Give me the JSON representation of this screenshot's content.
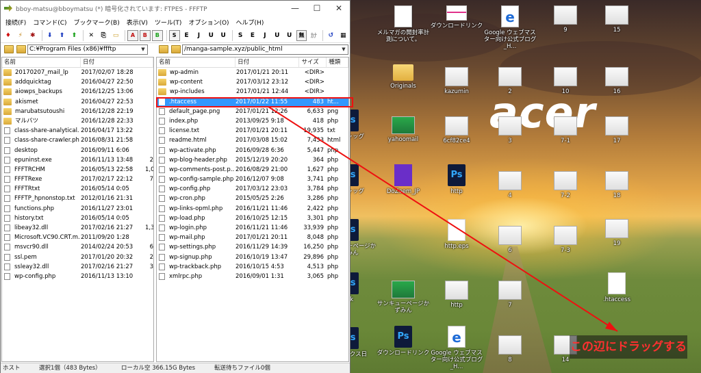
{
  "window": {
    "title": "bboy-matsu@bboymatsu (*) 暗号化されています: FTPES - FFFTP",
    "controls": {
      "minimize": "—",
      "maximize": "☐",
      "close": "✕"
    }
  },
  "menu": [
    "接続(F)",
    "コマンド(C)",
    "ブックマーク(B)",
    "表示(V)",
    "ツール(T)",
    "オプション(O)",
    "ヘルプ(H)"
  ],
  "toolbar_buttons": [
    "connect-icon",
    "quick-connect-icon",
    "disconnect-icon",
    "download-icon",
    "upload-icon",
    "mirror-upload-icon",
    "delete-icon",
    "rename-icon",
    "mkdir-icon",
    "ascii-icon",
    "binary-icon",
    "auto-icon",
    "sjis",
    "euc",
    "jis",
    "utf8",
    "utf8bom",
    "none",
    "kana",
    "refresh-icon",
    "list-icon"
  ],
  "toolbar_labels": {
    "ascii": "A",
    "binary": "B",
    "auto": "B",
    "sjis_l": "S",
    "euc_l": "E",
    "jis_l": "J",
    "utf8_l": "U",
    "utf8b_l": "U",
    "none_l": "無",
    "sjis_r": "S",
    "euc_r": "E",
    "jis_r": "J",
    "utf8_r": "U",
    "utf8b_r": "U",
    "none_r": "無",
    "kana": "ｶﾅ"
  },
  "local": {
    "path": "C:¥Program Files (x86)¥ffftp",
    "columns": {
      "name": "名前",
      "date": "日付"
    },
    "files": [
      {
        "type": "folder",
        "name": "20170207_mail_lp",
        "date": "2017/02/07 18:28",
        "size": ""
      },
      {
        "type": "folder",
        "name": "addquicktag",
        "date": "2016/04/27 22:50",
        "size": ""
      },
      {
        "type": "folder",
        "name": "aiowps_backups",
        "date": "2016/12/25 13:06",
        "size": ""
      },
      {
        "type": "folder",
        "name": "akismet",
        "date": "2016/04/27 22:53",
        "size": ""
      },
      {
        "type": "folder",
        "name": "marubatsutoushi",
        "date": "2016/12/28 22:19",
        "size": ""
      },
      {
        "type": "folder",
        "name": "マルバツ",
        "date": "2016/12/28 22:33",
        "size": ""
      },
      {
        "type": "file",
        "name": "class-share-analytical...",
        "date": "2016/04/17 13:22",
        "size": ""
      },
      {
        "type": "file",
        "name": "class-share-crawler.php",
        "date": "2016/08/31 21:58",
        "size": ""
      },
      {
        "type": "file",
        "name": "desktop",
        "date": "2016/09/11  6:06",
        "size": ""
      },
      {
        "type": "file",
        "name": "epuninst.exe",
        "date": "2016/11/13 13:48",
        "size": "2"
      },
      {
        "type": "file",
        "name": "FFFTRCHM",
        "date": "2016/05/13 22:58",
        "size": "1,0"
      },
      {
        "type": "file",
        "name": "FFFTRexe",
        "date": "2017/02/17 22:12",
        "size": "7"
      },
      {
        "type": "file",
        "name": "FFFTRtxt",
        "date": "2016/05/14  0:05",
        "size": ""
      },
      {
        "type": "file",
        "name": "FFFTP_hpnonstop.txt",
        "date": "2012/01/16 21:31",
        "size": ""
      },
      {
        "type": "file",
        "name": "functions.php",
        "date": "2016/11/27 23:01",
        "size": ""
      },
      {
        "type": "file",
        "name": "history.txt",
        "date": "2016/05/14  0:05",
        "size": ""
      },
      {
        "type": "file",
        "name": "libeay32.dll",
        "date": "2017/02/16 21:27",
        "size": "1,3"
      },
      {
        "type": "file",
        "name": "Microsoft.VC90.CRT.m...",
        "date": "2011/09/20  1:28",
        "size": ""
      },
      {
        "type": "file",
        "name": "msvcr90.dll",
        "date": "2014/02/24 20:53",
        "size": "6"
      },
      {
        "type": "file",
        "name": "ssl.pem",
        "date": "2017/01/20 20:32",
        "size": "2"
      },
      {
        "type": "file",
        "name": "ssleay32.dll",
        "date": "2017/02/16 21:27",
        "size": "3"
      },
      {
        "type": "file",
        "name": "wp-config.php",
        "date": "2016/11/13 13:10",
        "size": ""
      }
    ]
  },
  "remote": {
    "path": "/manga-sample.xyz/public_html",
    "columns": {
      "name": "名前",
      "date": "日付",
      "size": "サイズ",
      "kind": "種類"
    },
    "files": [
      {
        "type": "folder",
        "name": "wp-admin",
        "date": "2017/01/21 20:11",
        "size": "<DIR>",
        "kind": ""
      },
      {
        "type": "folder",
        "name": "wp-content",
        "date": "2017/03/12 23:12",
        "size": "<DIR>",
        "kind": ""
      },
      {
        "type": "folder",
        "name": "wp-includes",
        "date": "2017/01/21 12:44",
        "size": "<DIR>",
        "kind": ""
      },
      {
        "type": "file",
        "name": ".htaccess",
        "date": "2017/01/22 11:55",
        "size": "483",
        "kind": "ht...",
        "selected": true
      },
      {
        "type": "file",
        "name": "default_page.png",
        "date": "2017/01/21 12:26",
        "size": "6,633",
        "kind": "png"
      },
      {
        "type": "file",
        "name": "index.php",
        "date": "2013/09/25  9:18",
        "size": "418",
        "kind": "php"
      },
      {
        "type": "file",
        "name": "license.txt",
        "date": "2017/01/21 20:11",
        "size": "19,935",
        "kind": "txt"
      },
      {
        "type": "file",
        "name": "readme.html",
        "date": "2017/03/08 15:02",
        "size": "7,433",
        "kind": "html"
      },
      {
        "type": "file",
        "name": "wp-activate.php",
        "date": "2016/09/28  6:36",
        "size": "5,447",
        "kind": "php"
      },
      {
        "type": "file",
        "name": "wp-blog-header.php",
        "date": "2015/12/19 20:20",
        "size": "364",
        "kind": "php"
      },
      {
        "type": "file",
        "name": "wp-comments-post.p...",
        "date": "2016/08/29 21:00",
        "size": "1,627",
        "kind": "php"
      },
      {
        "type": "file",
        "name": "wp-config-sample.php",
        "date": "2016/12/07  9:08",
        "size": "3,741",
        "kind": "php"
      },
      {
        "type": "file",
        "name": "wp-config.php",
        "date": "2017/03/12 23:03",
        "size": "3,784",
        "kind": "php"
      },
      {
        "type": "file",
        "name": "wp-cron.php",
        "date": "2015/05/25  2:26",
        "size": "3,286",
        "kind": "php"
      },
      {
        "type": "file",
        "name": "wp-links-opml.php",
        "date": "2016/11/21 11:46",
        "size": "2,422",
        "kind": "php"
      },
      {
        "type": "file",
        "name": "wp-load.php",
        "date": "2016/10/25 12:15",
        "size": "3,301",
        "kind": "php"
      },
      {
        "type": "file",
        "name": "wp-login.php",
        "date": "2016/11/21 11:46",
        "size": "33,939",
        "kind": "php"
      },
      {
        "type": "file",
        "name": "wp-mail.php",
        "date": "2017/01/21 20:11",
        "size": "8,048",
        "kind": "php"
      },
      {
        "type": "file",
        "name": "wp-settings.php",
        "date": "2016/11/29 14:39",
        "size": "16,250",
        "kind": "php"
      },
      {
        "type": "file",
        "name": "wp-signup.php",
        "date": "2016/10/19 13:47",
        "size": "29,896",
        "kind": "php"
      },
      {
        "type": "file",
        "name": "wp-trackback.php",
        "date": "2016/10/15  4:53",
        "size": "4,513",
        "kind": "php"
      },
      {
        "type": "file",
        "name": "xmlrpc.php",
        "date": "2016/09/01  1:31",
        "size": "3,065",
        "kind": "php"
      }
    ]
  },
  "statusbar": {
    "mode": "ホスト",
    "selection": "選択1個（483 Bytes）",
    "local_free": "ローカル空 366.15G Bytes",
    "transfer_queue": "転送待ちファイル0個"
  },
  "desktop": {
    "brand_logo": "acer",
    "icons": [
      {
        "label": "メルマガの開封率計測について。",
        "glyph": "g-doc"
      },
      {
        "label": "ダウンロードリンク",
        "glyph": "g-pinkstripe"
      },
      {
        "label": "Google ウェブマスター向け公式ブログ_H...",
        "glyph": "g-ie"
      },
      {
        "label": "9",
        "glyph": "g-thumb"
      },
      {
        "label": "15",
        "glyph": "g-thumb"
      },
      {
        "label": "Originals",
        "glyph": "g-folder"
      },
      {
        "label": "kazumin",
        "glyph": "g-thumb"
      },
      {
        "label": "2",
        "glyph": "g-thumb"
      },
      {
        "label": "10",
        "glyph": "g-thumb"
      },
      {
        "label": "16",
        "glyph": "g-thumb"
      },
      {
        "label": "ージャッグ",
        "glyph": "g-ps"
      },
      {
        "label": "yahoomail",
        "glyph": "g-green"
      },
      {
        "label": "6cf82ce4",
        "glyph": "g-thumb"
      },
      {
        "label": "3",
        "glyph": "g-thumb"
      },
      {
        "label": "7-1",
        "glyph": "g-thumb"
      },
      {
        "label": "17",
        "glyph": "g-thumb"
      },
      {
        "label": "ージャッグ",
        "glyph": "g-ps"
      },
      {
        "label": "DoZeem_JP",
        "glyph": "g-purple"
      },
      {
        "label": "http",
        "glyph": "g-ps"
      },
      {
        "label": "4",
        "glyph": "g-thumb"
      },
      {
        "label": "7-2",
        "glyph": "g-thumb"
      },
      {
        "label": "18",
        "glyph": "g-thumb"
      },
      {
        "label": "サンキューページかずみん",
        "glyph": "g-ps"
      },
      {
        "label": "http.eps",
        "glyph": "g-blank"
      },
      {
        "label": "6",
        "glyph": "g-thumb"
      },
      {
        "label": "7-3",
        "glyph": "g-thumb"
      },
      {
        "label": "19",
        "glyph": "g-thumb"
      },
      {
        "label": "nk",
        "glyph": "g-ps"
      },
      {
        "label": "サンキューページかずみん",
        "glyph": "g-green"
      },
      {
        "label": "http",
        "glyph": "g-thumb"
      },
      {
        "label": "7",
        "glyph": "g-thumb"
      },
      {
        "label": ".htaccess",
        "glyph": "g-blank"
      },
      {
        "label": "リティクス日",
        "glyph": "g-ps"
      },
      {
        "label": "ダウンロードリンク",
        "glyph": "g-ps"
      },
      {
        "label": "Google ウェブマスター向け公式ブログ_H...",
        "glyph": "g-ie"
      },
      {
        "label": "8",
        "glyph": "g-thumb"
      },
      {
        "label": "14",
        "glyph": "g-thumb"
      }
    ]
  },
  "annotation": {
    "text": "この辺にドラッグする",
    "color": "#ff3030"
  }
}
